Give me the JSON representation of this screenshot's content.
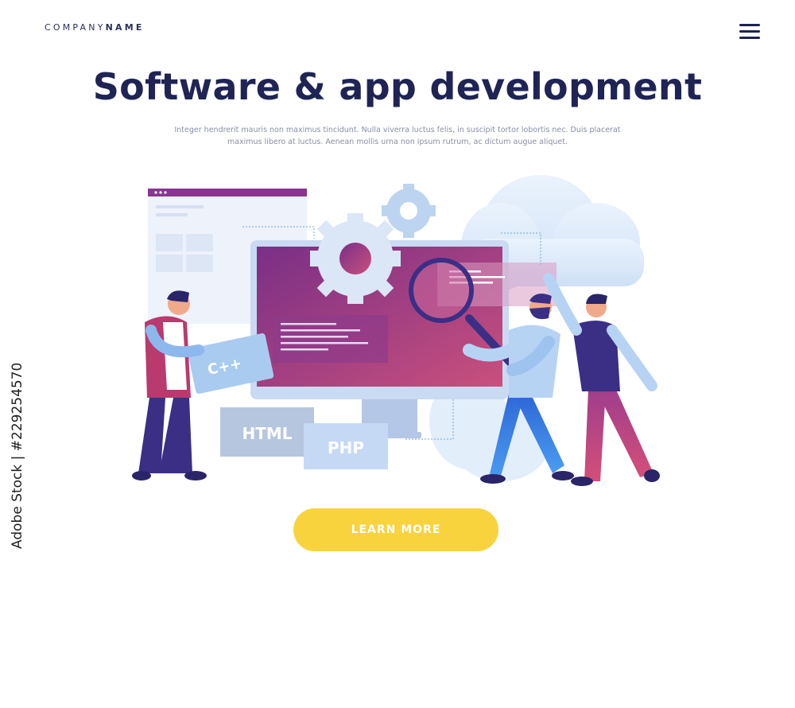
{
  "header": {
    "logo_company": "COMPANY",
    "logo_name": "NAME"
  },
  "hero": {
    "title": "Software & app development",
    "subtitle": "Integer hendrerit mauris non maximus tincidunt. Nulla viverra luctus felis, in suscipit tortor lobortis nec. Duis placerat maximus libero at luctus. Aenean mollis urna non ipsum rutrum, ac dictum augue aliquet."
  },
  "illustration": {
    "tags": {
      "cpp": "C++",
      "html": "HTML",
      "php": "PHP"
    }
  },
  "cta": {
    "label": "LEARN MORE"
  },
  "watermark": {
    "text": "Adobe Stock | #229254570"
  },
  "colors": {
    "title": "#1f2455",
    "accent_yellow": "#f9d33d",
    "accent_purple": "#7b2d86",
    "accent_pink": "#c84a8e",
    "light_blue": "#a9c8ef"
  }
}
